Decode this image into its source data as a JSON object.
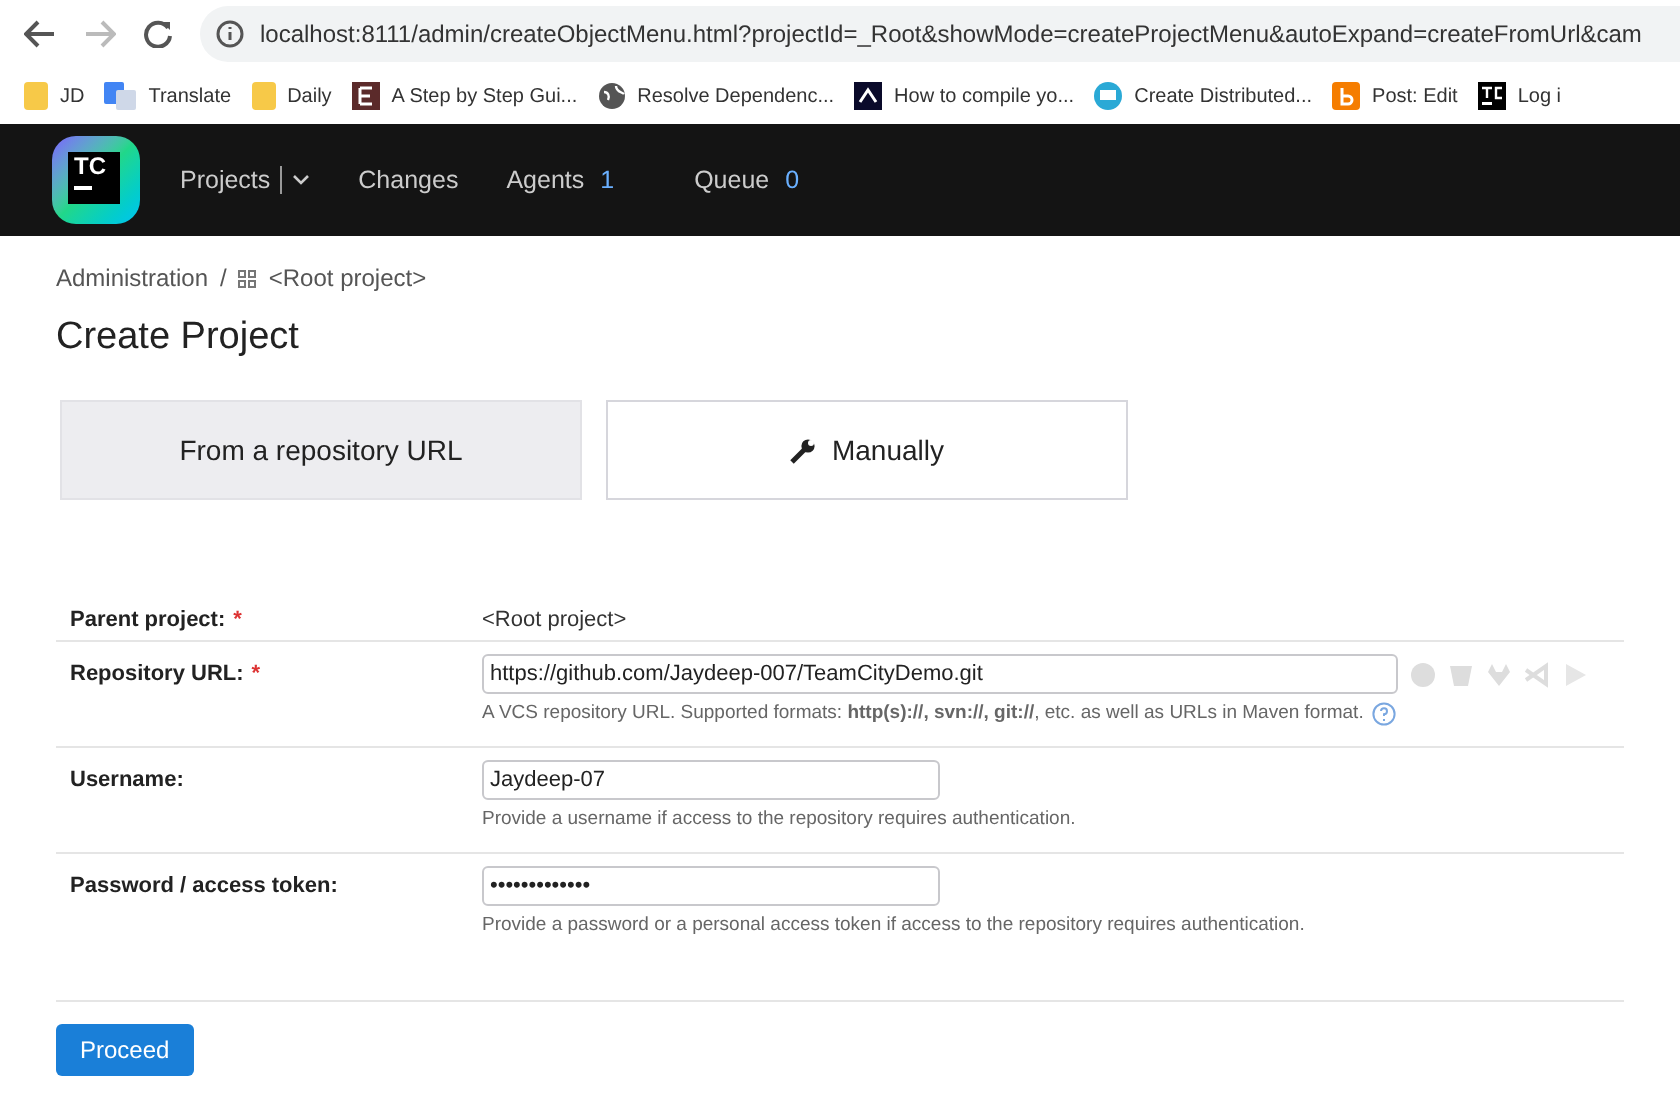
{
  "browser": {
    "url": "localhost:8111/admin/createObjectMenu.html?projectId=_Root&showMode=createProjectMenu&autoExpand=createFromUrl&cam",
    "bookmarks": [
      {
        "label": "JD"
      },
      {
        "label": "Translate"
      },
      {
        "label": "Daily"
      },
      {
        "label": "A Step by Step Gui..."
      },
      {
        "label": "Resolve Dependenc..."
      },
      {
        "label": "How to compile yo..."
      },
      {
        "label": "Create Distributed..."
      },
      {
        "label": "Post: Edit"
      },
      {
        "label": "Log i"
      }
    ]
  },
  "logo": {
    "text": "TC"
  },
  "nav": [
    {
      "label": "Projects",
      "kind": "dropdown"
    },
    {
      "label": "Changes",
      "kind": "link"
    },
    {
      "label": "Agents",
      "kind": "count",
      "count": "1"
    },
    {
      "label": "Queue",
      "kind": "count",
      "count": "0"
    }
  ],
  "breadcrumb": [
    {
      "label": "Administration",
      "kind": "text"
    },
    {
      "label": "<Root project>",
      "kind": "project"
    }
  ],
  "breadcrumb_separator": "/",
  "title": "Create Project",
  "tabs": [
    {
      "label": "From a repository URL",
      "selected": true,
      "icon": false
    },
    {
      "label": "Manually",
      "selected": false,
      "icon": true
    }
  ],
  "form": [
    {
      "label": "Parent project:",
      "required": true,
      "kind": "static",
      "value": "<Root project>"
    },
    {
      "label": "Repository URL:",
      "required": true,
      "kind": "url",
      "value": "https://github.com/Jaydeep-007/TeamCityDemo.git",
      "hint": "A VCS repository URL. Supported formats: **http(s)://, svn://, git://**, etc. as well as URLs in Maven format."
    },
    {
      "label": "Username:",
      "required": false,
      "kind": "text",
      "value": "Jaydeep-07",
      "hint": "Provide a username if access to the repository requires authentication."
    },
    {
      "label": "Password / access token:",
      "required": false,
      "kind": "text",
      "value": "•••••••••••••",
      "hint": "Provide a password or a personal access token if access to the repository requires authentication."
    }
  ],
  "required_mark": "*",
  "proceed_button": "Proceed"
}
